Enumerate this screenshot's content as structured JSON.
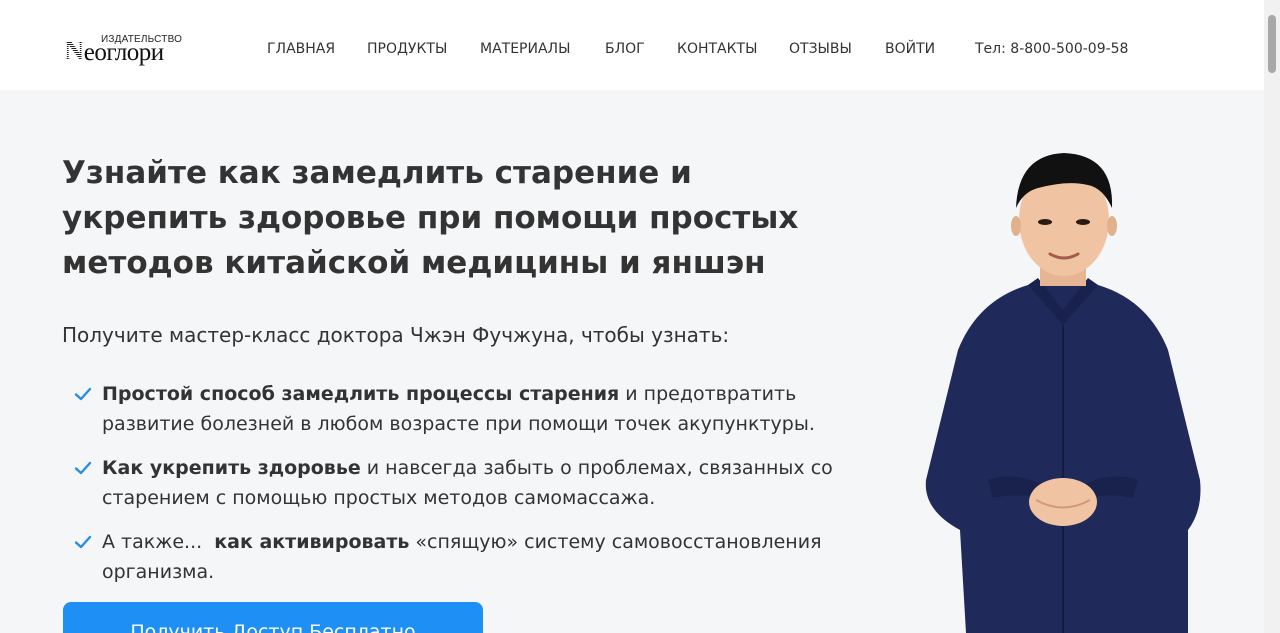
{
  "header": {
    "logo_small": "ИЗДАТЕЛЬСТВО",
    "logo_main_first": "N",
    "logo_main_rest": "еоглори",
    "nav": [
      "ГЛАВНАЯ",
      "ПРОДУКТЫ",
      "МАТЕРИАЛЫ",
      "БЛОГ",
      "КОНТАКТЫ",
      "ОТЗЫВЫ",
      "ВОЙТИ"
    ],
    "phone": "Тел: 8-800-500-09-58"
  },
  "hero": {
    "title": "Узнайте как замедлить старение и укрепить здоровье при помощи простых методов китайской медицины и яншэн",
    "lead": "Получите мастер-класс доктора Чжэн Фучжуна, чтобы узнать:",
    "benefits": [
      {
        "pre": "",
        "bold": "Простой способ замедлить процессы старения",
        "rest": " и предотвратить развитие болезней в любом возрасте при помощи точек акупунктуры."
      },
      {
        "pre": "",
        "bold": "Как укрепить здоровье",
        "rest": " и навсегда забыть о проблемах, связанных со старением с помощью простых методов самомассажа."
      },
      {
        "pre": "А также...  ",
        "bold": "как активировать",
        "rest": " «спящую» систему самовосстановления организма."
      }
    ],
    "cta": "Получить Доступ Бесплатно"
  },
  "colors": {
    "accent": "#1e8ff5",
    "check": "#2a8ce0",
    "shirt": "#1f2a5a",
    "background": "#f5f6f8"
  },
  "icons": {
    "check": "check-icon",
    "portrait": "doctor-portrait"
  }
}
